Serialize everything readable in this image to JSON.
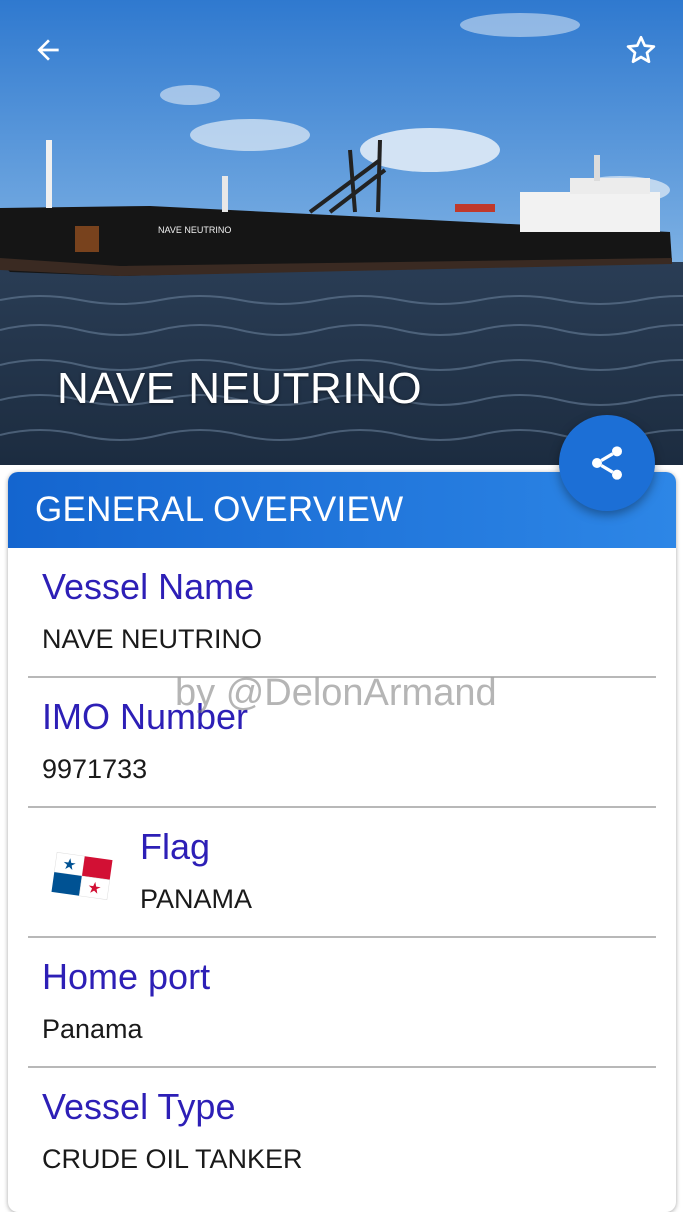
{
  "header": {
    "vessel_title": "NAVE NEUTRINO",
    "hull_text": "NAVE NEUTRINO",
    "back_icon": "arrow-left-icon",
    "favorite_icon": "star-outline-icon",
    "share_icon": "share-icon"
  },
  "card": {
    "title": "GENERAL OVERVIEW",
    "rows": [
      {
        "label": "Vessel Name",
        "value": "NAVE NEUTRINO"
      },
      {
        "label": "IMO Number",
        "value": "9971733"
      },
      {
        "label": "Flag",
        "value": "PANAMA"
      },
      {
        "label": "Home port",
        "value": "Panama"
      },
      {
        "label": "Vessel Type",
        "value": "CRUDE OIL TANKER"
      }
    ]
  },
  "watermark": "by @DelonArmand",
  "colors": {
    "accent": "#1c6fd6",
    "label": "#2d1fb6",
    "header_start": "#1465cf",
    "header_end": "#2d86e6"
  }
}
